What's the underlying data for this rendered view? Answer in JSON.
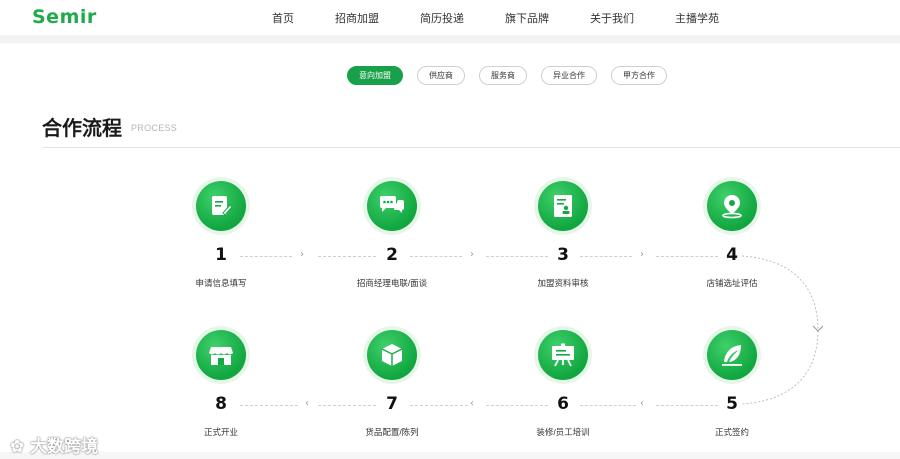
{
  "header": {
    "logo": "Semir",
    "nav": [
      "首页",
      "招商加盟",
      "简历投递",
      "旗下品牌",
      "关于我们",
      "主播学苑"
    ]
  },
  "tabs": [
    {
      "label": "意向加盟",
      "active": true
    },
    {
      "label": "供应商",
      "active": false
    },
    {
      "label": "服务商",
      "active": false
    },
    {
      "label": "异业合作",
      "active": false
    },
    {
      "label": "甲方合作",
      "active": false
    }
  ],
  "section": {
    "title": "合作流程",
    "subtitle": "PROCESS"
  },
  "steps": [
    {
      "num": "1",
      "label": "申请信息填写",
      "icon": "form-edit-icon"
    },
    {
      "num": "2",
      "label": "招商经理电联/面谈",
      "icon": "chat-bubbles-icon"
    },
    {
      "num": "3",
      "label": "加盟资料审核",
      "icon": "document-review-icon"
    },
    {
      "num": "4",
      "label": "店铺选址评估",
      "icon": "location-pin-icon"
    },
    {
      "num": "5",
      "label": "正式签约",
      "icon": "feather-pen-icon"
    },
    {
      "num": "6",
      "label": "装修/员工培训",
      "icon": "training-board-icon"
    },
    {
      "num": "7",
      "label": "货品配置/陈列",
      "icon": "product-box-icon"
    },
    {
      "num": "8",
      "label": "正式开业",
      "icon": "storefront-icon"
    }
  ],
  "watermark": "大数跨境",
  "colors": {
    "brand_green": "#1faa4b",
    "active_tab": "#19a04a"
  }
}
